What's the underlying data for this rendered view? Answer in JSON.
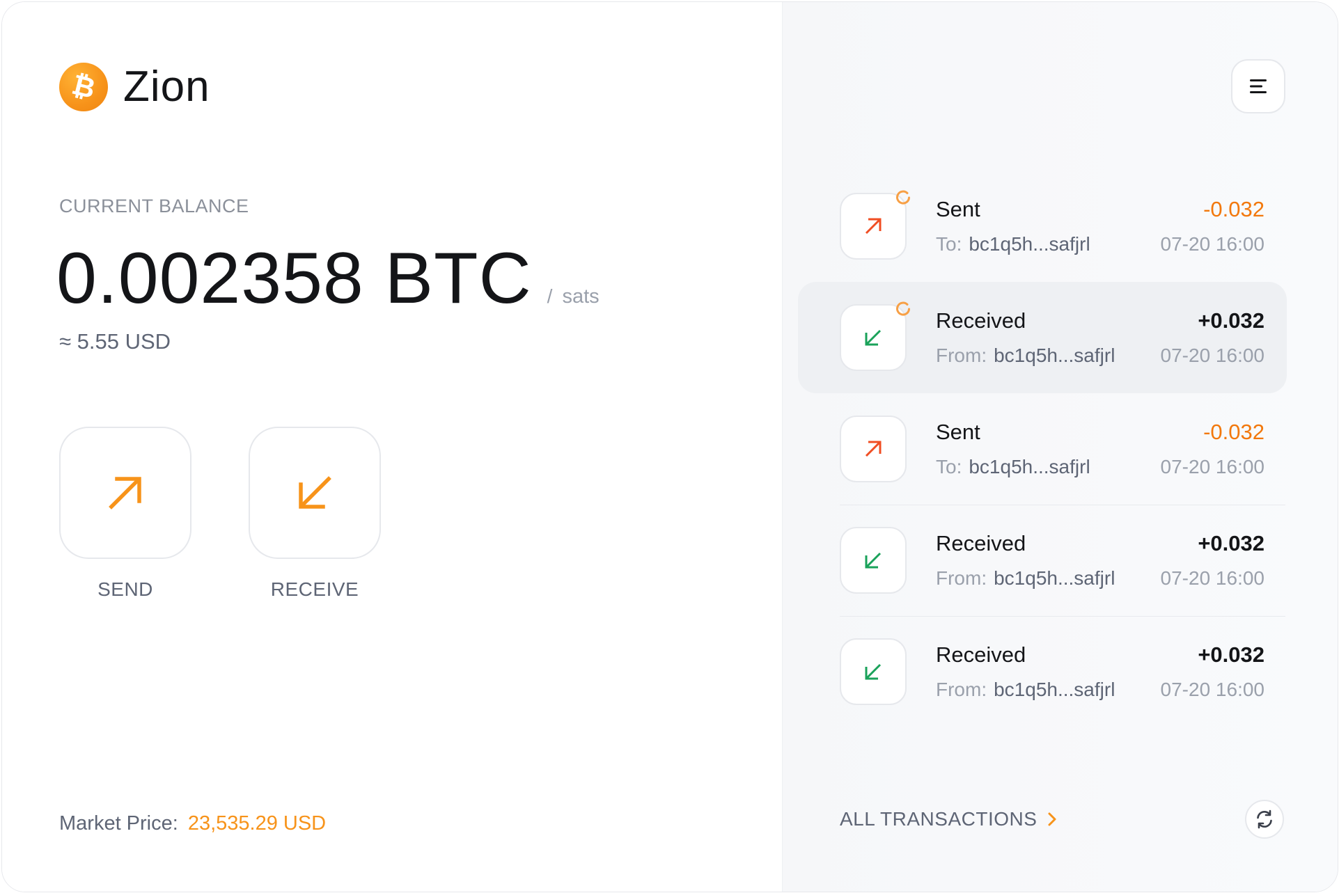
{
  "app": {
    "name": "Zion",
    "logo_icon": "bitcoin-icon"
  },
  "balance": {
    "caption": "CURRENT BALANCE",
    "value": "0.002358 BTC",
    "unit_separator": "/",
    "unit_alt": "sats",
    "fiat": "≈ 5.55 USD"
  },
  "actions": {
    "send_label": "SEND",
    "receive_label": "RECEIVE"
  },
  "market": {
    "label": "Market Price:",
    "value": "23,535.29 USD"
  },
  "transactions": [
    {
      "type": "Sent",
      "direction_label": "To:",
      "address": "bc1q5h...safjrl",
      "amount": "-0.032",
      "time": "07-20 16:00",
      "pending": true
    },
    {
      "type": "Received",
      "direction_label": "From:",
      "address": "bc1q5h...safjrl",
      "amount": "+0.032",
      "time": "07-20 16:00",
      "pending": true
    },
    {
      "type": "Sent",
      "direction_label": "To:",
      "address": "bc1q5h...safjrl",
      "amount": "-0.032",
      "time": "07-20 16:00",
      "pending": false
    },
    {
      "type": "Received",
      "direction_label": "From:",
      "address": "bc1q5h...safjrl",
      "amount": "+0.032",
      "time": "07-20 16:00",
      "pending": false
    },
    {
      "type": "Received",
      "direction_label": "From:",
      "address": "bc1q5h...safjrl",
      "amount": "+0.032",
      "time": "07-20 16:00",
      "pending": false
    }
  ],
  "footer": {
    "all_transactions_label": "ALL TRANSACTIONS"
  },
  "colors": {
    "brand_orange": "#f7931a",
    "sent_red": "#f04e23",
    "received_green": "#1aa25a",
    "text_muted": "#9aa0ab"
  }
}
